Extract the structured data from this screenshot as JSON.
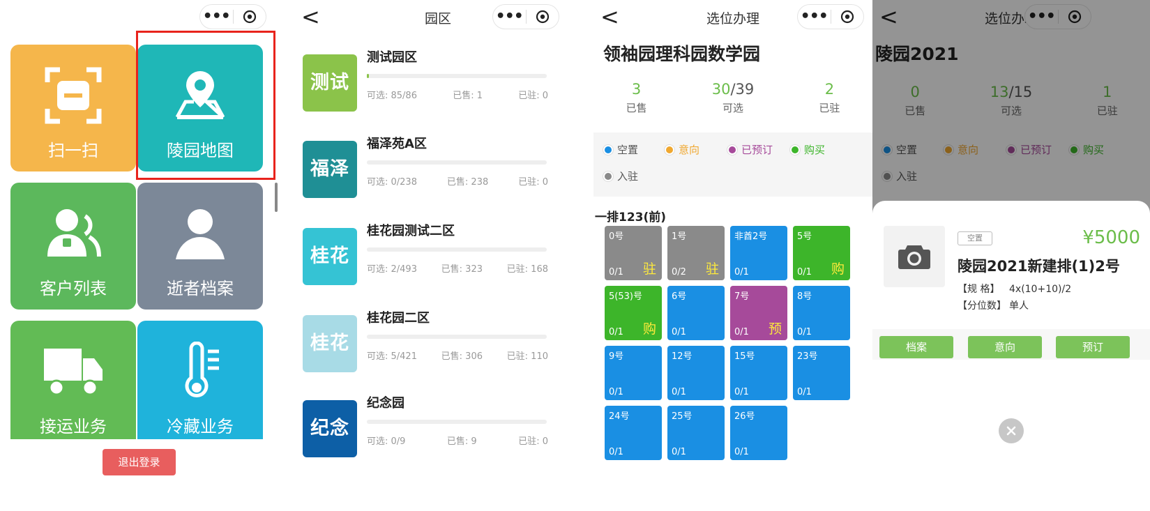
{
  "screen1": {
    "tiles": [
      {
        "label": "扫一扫",
        "icon": "scan-icon",
        "color": "#f5b64b"
      },
      {
        "label": "陵园地图",
        "icon": "map-pin-icon",
        "color": "#1fb7b7"
      },
      {
        "label": "客户列表",
        "icon": "customers-icon",
        "color": "#5cb85c"
      },
      {
        "label": "逝者档案",
        "icon": "person-icon",
        "color": "#7c8898"
      },
      {
        "label": "接运业务",
        "icon": "truck-icon",
        "color": "#62bb55"
      },
      {
        "label": "冷藏业务",
        "icon": "thermometer-icon",
        "color": "#1fb3db"
      }
    ],
    "logout_label": "退出登录"
  },
  "screen2": {
    "title": "园区",
    "parks": [
      {
        "badge": "测试",
        "name": "测试园区",
        "color": "#8bc34a",
        "progress": 0.01,
        "available": "可选: 85/86",
        "sold": "已售: 1",
        "occupied": "已驻: 0"
      },
      {
        "badge": "福泽",
        "name": "福泽苑A区",
        "color": "#1f8f95",
        "progress": 0,
        "available": "可选: 0/238",
        "sold": "已售: 238",
        "occupied": "已驻: 0"
      },
      {
        "badge": "桂花",
        "name": "桂花园测试二区",
        "color": "#35c3d4",
        "progress": 0,
        "available": "可选: 2/493",
        "sold": "已售: 323",
        "occupied": "已驻: 168"
      },
      {
        "badge": "桂花",
        "name": "桂花园二区",
        "color": "#a8dbe6",
        "progress": 0,
        "available": "可选: 5/421",
        "sold": "已售: 306",
        "occupied": "已驻: 110"
      },
      {
        "badge": "纪念",
        "name": "纪念园",
        "color": "#0d5fa6",
        "progress": 0,
        "available": "可选: 0/9",
        "sold": "已售: 9",
        "occupied": "已驻: 0"
      }
    ]
  },
  "screen3": {
    "title": "选位办理",
    "area_title": "领袖园理科园数学园",
    "stats": {
      "sold": "3",
      "sold_label": "已售",
      "available": "30",
      "total": "/39",
      "available_label": "可选",
      "occupied": "2",
      "occupied_label": "已驻"
    },
    "legend": [
      {
        "label": "空置",
        "color": "#1a8fe3",
        "text_color": "#555"
      },
      {
        "label": "意向",
        "color": "#f0a830",
        "text_color": "#f0a830"
      },
      {
        "label": "已预订",
        "color": "#a64a9a",
        "text_color": "#a64a9a"
      },
      {
        "label": "购买",
        "color": "#3db52a",
        "text_color": "#3db52a"
      },
      {
        "label": "入驻",
        "color": "#8a8a8a",
        "text_color": "#555"
      }
    ],
    "row_title": "一排123(前)",
    "cells": [
      {
        "no": "0号",
        "cnt": "0/1",
        "st": "驻",
        "color": "#8a8a8a"
      },
      {
        "no": "1号",
        "cnt": "0/2",
        "st": "驻",
        "color": "#8a8a8a"
      },
      {
        "no": "非酋2号",
        "cnt": "0/1",
        "st": "",
        "color": "#1a8fe3"
      },
      {
        "no": "5号",
        "cnt": "0/1",
        "st": "购",
        "color": "#3db52a"
      },
      {
        "no": "5(53)号",
        "cnt": "0/1",
        "st": "购",
        "color": "#3db52a"
      },
      {
        "no": "6号",
        "cnt": "0/1",
        "st": "",
        "color": "#1a8fe3"
      },
      {
        "no": "7号",
        "cnt": "0/1",
        "st": "预",
        "color": "#a64a9a"
      },
      {
        "no": "8号",
        "cnt": "0/1",
        "st": "",
        "color": "#1a8fe3"
      },
      {
        "no": "9号",
        "cnt": "0/1",
        "st": "",
        "color": "#1a8fe3"
      },
      {
        "no": "12号",
        "cnt": "0/1",
        "st": "",
        "color": "#1a8fe3"
      },
      {
        "no": "15号",
        "cnt": "0/1",
        "st": "",
        "color": "#1a8fe3"
      },
      {
        "no": "23号",
        "cnt": "0/1",
        "st": "",
        "color": "#1a8fe3"
      },
      {
        "no": "24号",
        "cnt": "0/1",
        "st": "",
        "color": "#1a8fe3"
      },
      {
        "no": "25号",
        "cnt": "0/1",
        "st": "",
        "color": "#1a8fe3"
      },
      {
        "no": "26号",
        "cnt": "0/1",
        "st": "",
        "color": "#1a8fe3"
      }
    ]
  },
  "screen4": {
    "title": "选位办理",
    "area_title": "陵园2021",
    "stats": {
      "sold": "0",
      "sold_label": "已售",
      "available": "13",
      "total": "/15",
      "available_label": "可选",
      "occupied": "1",
      "occupied_label": "已驻"
    },
    "legend": [
      {
        "label": "空置",
        "color": "#1a8fe3",
        "text_color": "#555"
      },
      {
        "label": "意向",
        "color": "#f0a830",
        "text_color": "#f0a830"
      },
      {
        "label": "已预订",
        "color": "#a64a9a",
        "text_color": "#a64a9a"
      },
      {
        "label": "购买",
        "color": "#3db52a",
        "text_color": "#3db52a"
      },
      {
        "label": "入驻",
        "color": "#8a8a8a",
        "text_color": "#555"
      }
    ],
    "sheet": {
      "tag": "空置",
      "price": "¥5000",
      "name": "陵园2021新建排(1)2号",
      "spec_key": "【规 格】",
      "spec_val": "4x(10+10)/2",
      "count_key": "【分位数】",
      "count_val": "单人",
      "buttons": [
        "档案",
        "意向",
        "预订"
      ]
    }
  }
}
